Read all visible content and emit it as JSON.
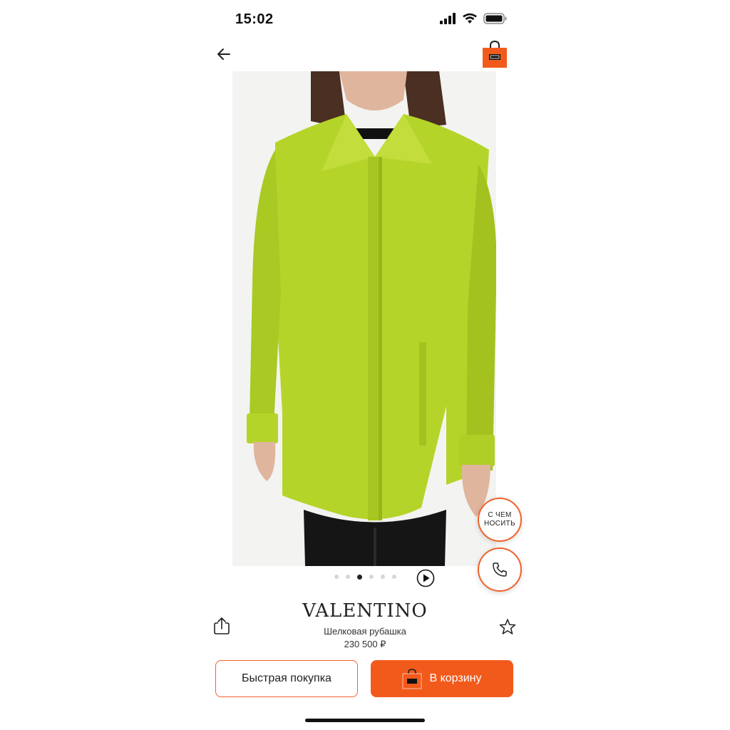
{
  "status_bar": {
    "time": "15:02"
  },
  "header": {
    "back_icon": "arrow-left-icon",
    "bag_icon": "shopping-bag-icon"
  },
  "product": {
    "brand": "VALENTINO",
    "name": "Шелковая рубашка",
    "price": "230 500 ₽",
    "image_desc_icon": "product-photo",
    "carousel": {
      "count": 6,
      "active_index": 2
    }
  },
  "floating": {
    "look_label_line1": "С ЧЕМ",
    "look_label_line2": "НОСИТЬ",
    "call_icon": "phone-icon"
  },
  "actions": {
    "quick_buy_label": "Быстрая покупка",
    "add_to_cart_label": "В корзину"
  },
  "colors": {
    "accent": "#f25a1c",
    "shirt": "#b7d62a"
  }
}
